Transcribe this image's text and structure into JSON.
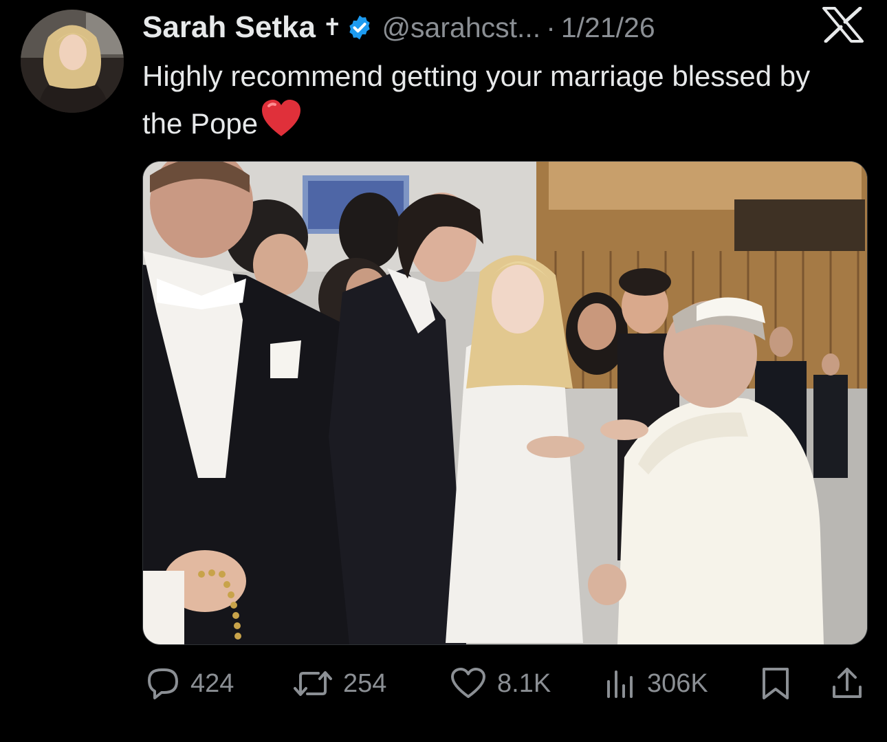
{
  "tweet": {
    "author_name": "Sarah Setka",
    "cross_glyph": "✝",
    "handle": "@sarahcst...",
    "separator": "·",
    "date": "1/21/26",
    "text": "Highly recommend getting your marriage blessed by the Pope",
    "emoji": "❤️"
  },
  "metrics": {
    "replies": "424",
    "reposts": "254",
    "likes": "8.1K",
    "views": "306K"
  },
  "colors": {
    "background": "#000000",
    "text_primary": "#e7e9ea",
    "text_secondary": "#8b8f94",
    "verified": "#1d9bf0",
    "heart": "#e0303a"
  },
  "icons": {
    "verified": "verified-badge-icon",
    "platform": "x-logo-icon",
    "reply": "reply-bubble-icon",
    "repost": "repost-arrows-icon",
    "like": "heart-outline-icon",
    "views": "bar-chart-icon",
    "bookmark": "bookmark-icon",
    "share": "share-upload-icon"
  }
}
